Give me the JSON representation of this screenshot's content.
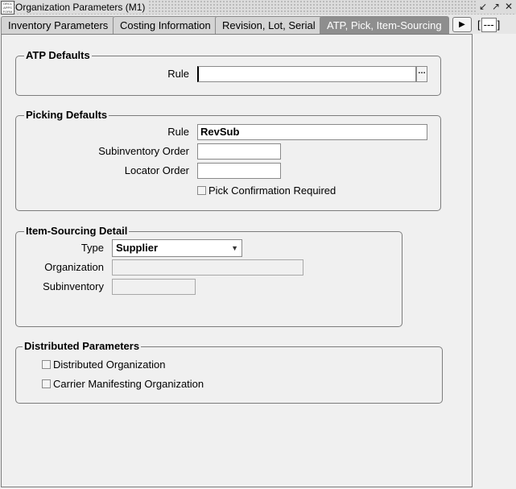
{
  "window": {
    "title": "Organization Parameters (M1)",
    "controls": [
      "↙",
      "↗",
      "✕"
    ]
  },
  "tabs": [
    {
      "label": "Inventory Parameters"
    },
    {
      "label": "Costing Information"
    },
    {
      "label": "Revision, Lot, Serial"
    },
    {
      "label": "ATP, Pick, Item-Sourcing",
      "active": true
    }
  ],
  "tab_more": {
    "left": "[",
    "value": "---",
    "right": "]"
  },
  "atp": {
    "legend": "ATP Defaults",
    "rule_label": "Rule",
    "rule_value": "",
    "lov_label": "…"
  },
  "picking": {
    "legend": "Picking Defaults",
    "rule_label": "Rule",
    "rule_value": "RevSub",
    "subinv_label": "Subinventory Order",
    "subinv_value": "",
    "locator_label": "Locator Order",
    "locator_value": "",
    "confirm_label": "Pick Confirmation Required",
    "confirm_checked": false
  },
  "sourcing": {
    "legend": "Item-Sourcing Detail",
    "type_label": "Type",
    "type_value": "Supplier",
    "org_label": "Organization",
    "org_value": "",
    "subinv_label": "Subinventory",
    "subinv_value": ""
  },
  "distributed": {
    "legend": "Distributed Parameters",
    "dist_org_label": "Distributed Organization",
    "dist_org_checked": false,
    "carrier_label": "Carrier Manifesting Organization",
    "carrier_checked": false
  }
}
